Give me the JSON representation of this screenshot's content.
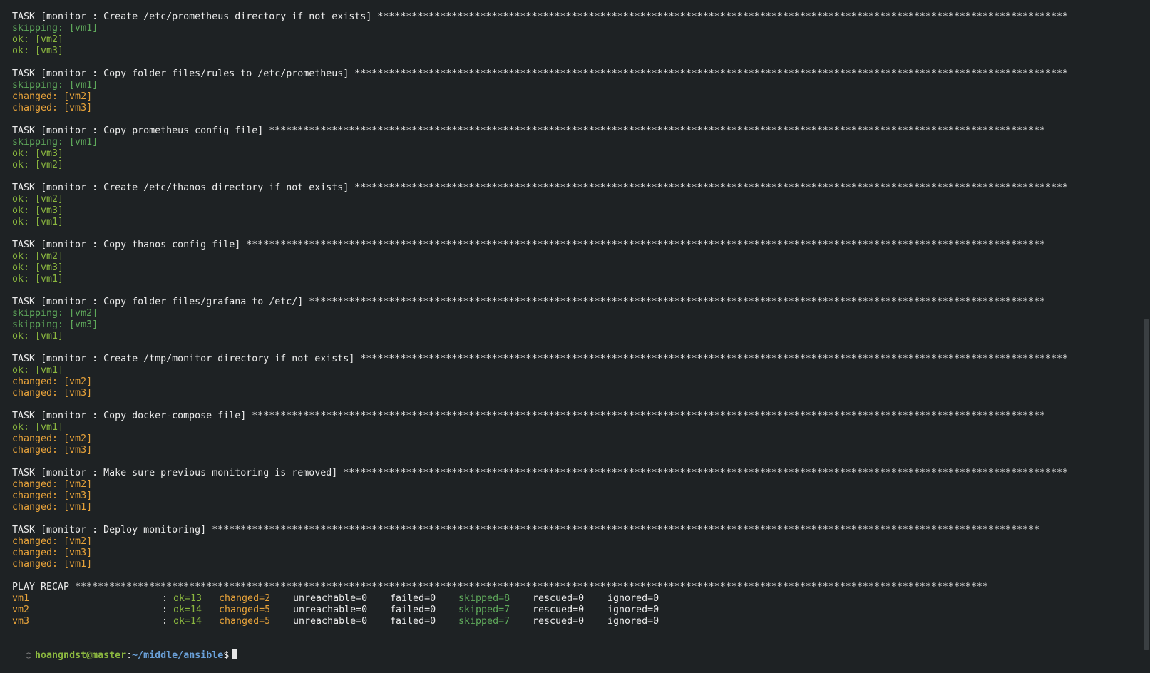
{
  "tasks": [
    {
      "title": "TASK [monitor : Create /etc/prometheus directory if not exists]",
      "stars": "*************************************************************************************************************************",
      "results": [
        {
          "status": "skipping",
          "text": "skipping: [vm1]"
        },
        {
          "status": "ok",
          "text": "ok: [vm2]"
        },
        {
          "status": "ok",
          "text": "ok: [vm3]"
        }
      ]
    },
    {
      "title": "TASK [monitor : Copy folder files/rules to /etc/prometheus]",
      "stars": "*****************************************************************************************************************************",
      "results": [
        {
          "status": "skipping",
          "text": "skipping: [vm1]"
        },
        {
          "status": "changed",
          "text": "changed: [vm2]"
        },
        {
          "status": "changed",
          "text": "changed: [vm3]"
        }
      ]
    },
    {
      "title": "TASK [monitor : Copy prometheus config file]",
      "stars": "****************************************************************************************************************************************",
      "results": [
        {
          "status": "skipping",
          "text": "skipping: [vm1]"
        },
        {
          "status": "ok",
          "text": "ok: [vm3]"
        },
        {
          "status": "ok",
          "text": "ok: [vm2]"
        }
      ]
    },
    {
      "title": "TASK [monitor : Create /etc/thanos directory if not exists]",
      "stars": "*****************************************************************************************************************************",
      "results": [
        {
          "status": "ok",
          "text": "ok: [vm2]"
        },
        {
          "status": "ok",
          "text": "ok: [vm3]"
        },
        {
          "status": "ok",
          "text": "ok: [vm1]"
        }
      ]
    },
    {
      "title": "TASK [monitor : Copy thanos config file]",
      "stars": "********************************************************************************************************************************************",
      "results": [
        {
          "status": "ok",
          "text": "ok: [vm2]"
        },
        {
          "status": "ok",
          "text": "ok: [vm3]"
        },
        {
          "status": "ok",
          "text": "ok: [vm1]"
        }
      ]
    },
    {
      "title": "TASK [monitor : Copy folder files/grafana to /etc/]",
      "stars": "*********************************************************************************************************************************",
      "results": [
        {
          "status": "skipping",
          "text": "skipping: [vm2]"
        },
        {
          "status": "skipping",
          "text": "skipping: [vm3]"
        },
        {
          "status": "ok",
          "text": "ok: [vm1]"
        }
      ]
    },
    {
      "title": "TASK [monitor : Create /tmp/monitor directory if not exists]",
      "stars": "****************************************************************************************************************************",
      "results": [
        {
          "status": "ok",
          "text": "ok: [vm1]"
        },
        {
          "status": "changed",
          "text": "changed: [vm2]"
        },
        {
          "status": "changed",
          "text": "changed: [vm3]"
        }
      ]
    },
    {
      "title": "TASK [monitor : Copy docker-compose file]",
      "stars": "*******************************************************************************************************************************************",
      "results": [
        {
          "status": "ok",
          "text": "ok: [vm1]"
        },
        {
          "status": "changed",
          "text": "changed: [vm2]"
        },
        {
          "status": "changed",
          "text": "changed: [vm3]"
        }
      ]
    },
    {
      "title": "TASK [monitor : Make sure previous monitoring is removed]",
      "stars": "*******************************************************************************************************************************",
      "results": [
        {
          "status": "changed",
          "text": "changed: [vm2]"
        },
        {
          "status": "changed",
          "text": "changed: [vm3]"
        },
        {
          "status": "changed",
          "text": "changed: [vm1]"
        }
      ]
    },
    {
      "title": "TASK [monitor : Deploy monitoring]",
      "stars": "*************************************************************************************************************************************************",
      "results": [
        {
          "status": "changed",
          "text": "changed: [vm2]"
        },
        {
          "status": "changed",
          "text": "changed: [vm3]"
        },
        {
          "status": "changed",
          "text": "changed: [vm1]"
        }
      ]
    }
  ],
  "recap": {
    "title": "PLAY RECAP",
    "stars": "****************************************************************************************************************************************************************",
    "separator": ":",
    "hosts": [
      {
        "host": "vm1",
        "ok": "ok=13",
        "changed": "changed=2",
        "unreachable": "unreachable=0",
        "failed": "failed=0",
        "skipped": "skipped=8",
        "rescued": "rescued=0",
        "ignored": "ignored=0"
      },
      {
        "host": "vm2",
        "ok": "ok=14",
        "changed": "changed=5",
        "unreachable": "unreachable=0",
        "failed": "failed=0",
        "skipped": "skipped=7",
        "rescued": "rescued=0",
        "ignored": "ignored=0"
      },
      {
        "host": "vm3",
        "ok": "ok=14",
        "changed": "changed=5",
        "unreachable": "unreachable=0",
        "failed": "failed=0",
        "skipped": "skipped=7",
        "rescued": "rescued=0",
        "ignored": "ignored=0"
      }
    ]
  },
  "prompt": {
    "marker": "○",
    "user_host": "hoangndst@master",
    "colon": ":",
    "path": "~/middle/ansible",
    "dollar": "$"
  },
  "colors": {
    "background": "#1e2224",
    "ok": "#8bb73f",
    "skipping": "#5fa95b",
    "changed": "#e8a33a",
    "text": "#ececec",
    "path": "#6aa0d8"
  }
}
